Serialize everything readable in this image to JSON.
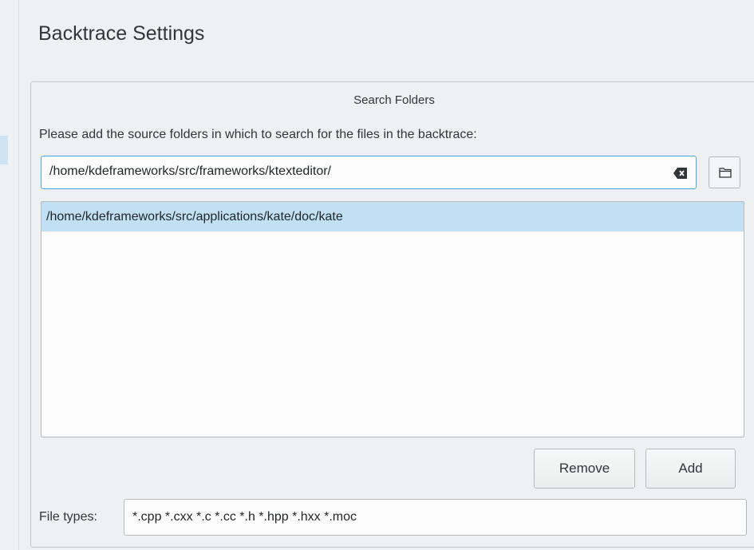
{
  "page": {
    "title": "Backtrace Settings"
  },
  "search_folders": {
    "group_title": "Search Folders",
    "instruction": "Please add the source folders in which to search for the files in the backtrace:",
    "path_input_value": "/home/kdeframeworks/src/frameworks/ktexteditor/",
    "folders": [
      "/home/kdeframeworks/src/applications/kate/doc/kate"
    ],
    "remove_label": "Remove",
    "add_label": "Add"
  },
  "file_types": {
    "label": "File types:",
    "value": "*.cpp *.cxx *.c *.cc *.h *.hpp *.hxx *.moc"
  },
  "icons": {
    "clear": "clear-text-icon",
    "browse": "folder-open-icon"
  },
  "colors": {
    "accent": "#3daee9",
    "selection": "#c2e0f4",
    "background": "#eff0f1"
  }
}
